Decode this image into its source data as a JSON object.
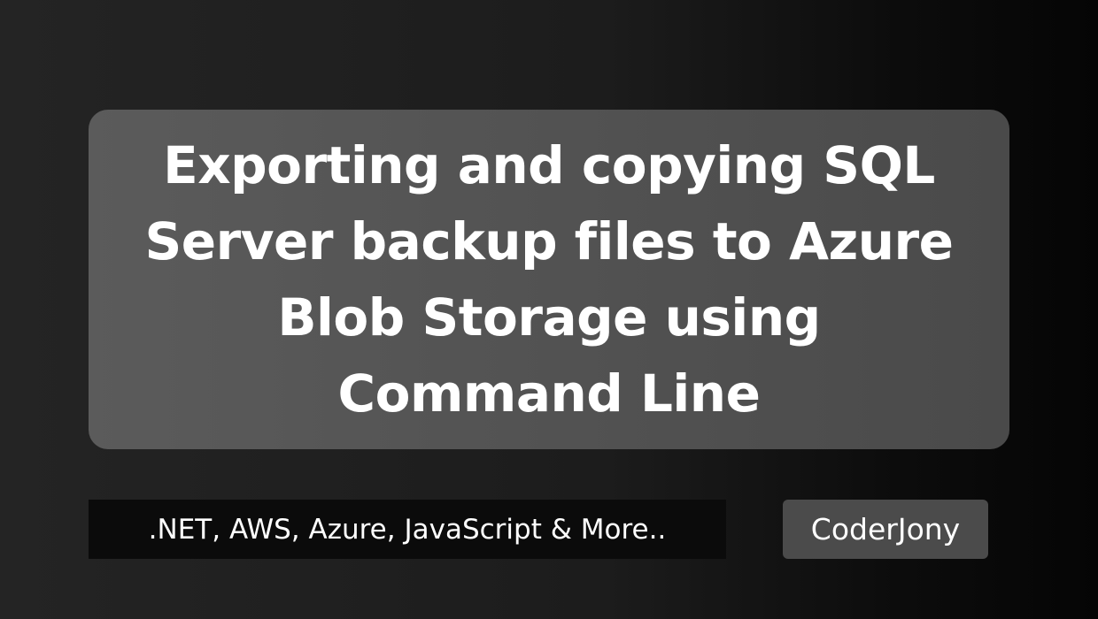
{
  "title_card": {
    "lines": [
      "Exporting and copying SQL",
      "Server backup files to Azure",
      "Blob Storage using",
      "Command Line"
    ]
  },
  "tagline": {
    "text": ".NET, AWS, Azure, JavaScript & More.."
  },
  "brand": {
    "name": "CoderJony"
  },
  "colors": {
    "background_left": "#242424",
    "background_right": "#050505",
    "card": "#555555",
    "tagline_bg": "#0b0b0b",
    "badge_bg": "#4b4b4b",
    "text": "#ffffff"
  }
}
